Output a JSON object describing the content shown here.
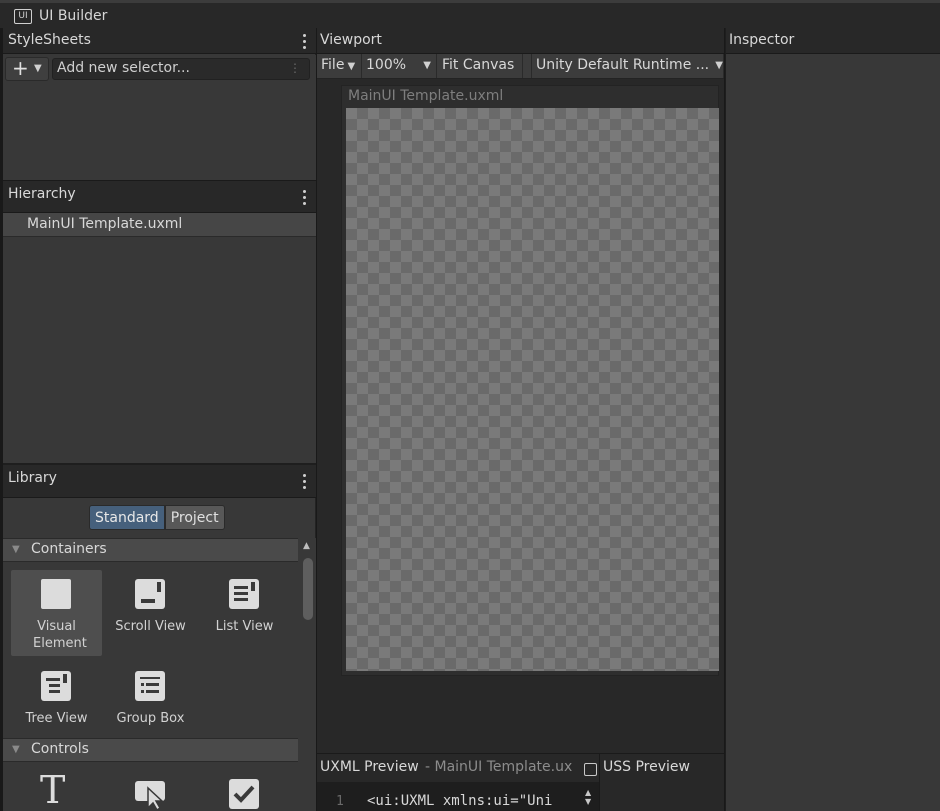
{
  "window": {
    "title": "UI Builder",
    "icon_text": "UI"
  },
  "stylesheets": {
    "title": "StyleSheets",
    "add_label": "+",
    "selector_placeholder": "Add new selector..."
  },
  "hierarchy": {
    "title": "Hierarchy",
    "items": [
      {
        "label": "MainUI Template.uxml"
      }
    ]
  },
  "library": {
    "title": "Library",
    "tabs": [
      {
        "label": "Standard",
        "selected": true
      },
      {
        "label": "Project",
        "selected": false
      }
    ],
    "sections": [
      {
        "label": "Containers",
        "items": [
          {
            "label": "Visual Element",
            "icon": "visual-element-icon"
          },
          {
            "label": "Scroll View",
            "icon": "scroll-view-icon"
          },
          {
            "label": "List View",
            "icon": "list-view-icon"
          },
          {
            "label": "Tree View",
            "icon": "tree-view-icon"
          },
          {
            "label": "Group Box",
            "icon": "group-box-icon"
          }
        ]
      },
      {
        "label": "Controls",
        "items": [
          {
            "label": "",
            "icon": "label-icon"
          },
          {
            "label": "",
            "icon": "button-icon"
          },
          {
            "label": "",
            "icon": "toggle-icon"
          }
        ]
      }
    ]
  },
  "viewport": {
    "title": "Viewport",
    "toolbar": {
      "file_label": "File",
      "zoom": "100%",
      "fit_canvas": "Fit Canvas",
      "theme": "Unity Default Runtime ..."
    },
    "canvas_title": "MainUI Template.uxml"
  },
  "preview": {
    "uxml_tab": "UXML Preview",
    "uxml_file": "- MainUI Template.ux",
    "uss_tab": "USS Preview",
    "code_line_number": "1",
    "code_text": "<ui:UXML xmlns:ui=\"Uni"
  },
  "inspector": {
    "title": "Inspector"
  },
  "colors": {
    "accent": "#46607c",
    "panel": "#383838",
    "header": "#282828"
  }
}
